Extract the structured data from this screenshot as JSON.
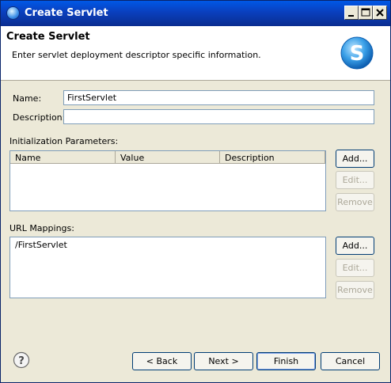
{
  "window": {
    "title": "Create Servlet"
  },
  "header": {
    "title": "Create Servlet",
    "description": "Enter servlet deployment descriptor specific information.",
    "logo_letter": "S"
  },
  "form": {
    "name_label": "Name:",
    "name_value": "FirstServlet",
    "description_label": "Description:",
    "description_value": ""
  },
  "init_params": {
    "label": "Initialization Parameters:",
    "columns": [
      "Name",
      "Value",
      "Description"
    ],
    "rows": [],
    "add_label": "Add...",
    "edit_label": "Edit...",
    "remove_label": "Remove"
  },
  "url_mappings": {
    "label": "URL Mappings:",
    "items": [
      "/FirstServlet"
    ],
    "add_label": "Add...",
    "edit_label": "Edit...",
    "remove_label": "Remove"
  },
  "footer": {
    "back_label": "< Back",
    "next_label": "Next >",
    "finish_label": "Finish",
    "cancel_label": "Cancel"
  },
  "icons": {
    "window_icon": "eclipse-icon",
    "logo": "servlet-logo-icon",
    "help": "help-icon"
  },
  "colors": {
    "titlebar": "#0a3fbd",
    "dialog_bg": "#ece9d8",
    "logo": "#1e88d6"
  }
}
